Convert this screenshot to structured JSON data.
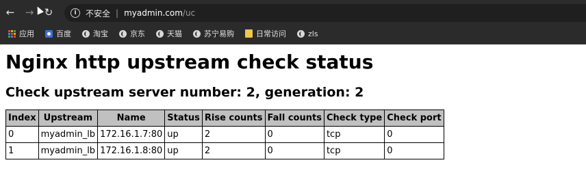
{
  "browser": {
    "security_label": "不安全",
    "url_host": "myadmin.com",
    "url_path": "/uc",
    "bookmarks": [
      {
        "label": "应用",
        "icon": "apps-grid-icon"
      },
      {
        "label": "百度",
        "icon": "baidu-paw-icon"
      },
      {
        "label": "淘宝",
        "icon": "globe-icon"
      },
      {
        "label": "京东",
        "icon": "globe-icon"
      },
      {
        "label": "天猫",
        "icon": "globe-icon"
      },
      {
        "label": "苏宁易购",
        "icon": "globe-icon"
      },
      {
        "label": "日常访问",
        "icon": "folder-icon"
      },
      {
        "label": "zls",
        "icon": "globe-icon"
      }
    ],
    "colors": {
      "chrome_bg": "#2b2b2b",
      "omnibox_bg": "#1f1f1f",
      "folder": "#f1c64a",
      "baidu": "#3b6fd8"
    }
  },
  "page": {
    "title": "Nginx http upstream check status",
    "subtitle": "Check upstream server number: 2, generation: 2",
    "table": {
      "headers": [
        "Index",
        "Upstream",
        "Name",
        "Status",
        "Rise counts",
        "Fall counts",
        "Check type",
        "Check port"
      ],
      "rows": [
        [
          "0",
          "myadmin_lb",
          "172.16.1.7:80",
          "up",
          "2",
          "0",
          "tcp",
          "0"
        ],
        [
          "1",
          "myadmin_lb",
          "172.16.1.8:80",
          "up",
          "2",
          "0",
          "tcp",
          "0"
        ]
      ],
      "header_bg": "#c0c0c0"
    }
  }
}
